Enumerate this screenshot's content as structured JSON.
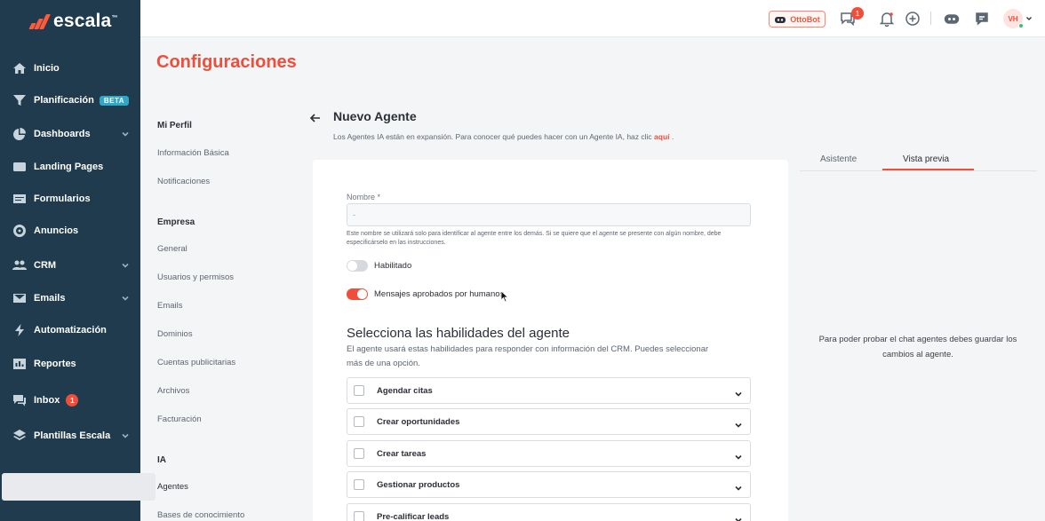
{
  "brand": {
    "name": "escala",
    "tm": "™"
  },
  "sidebar": {
    "items": [
      {
        "label": "Inicio",
        "icon": "home-icon"
      },
      {
        "label": "Planificación",
        "icon": "funnel-icon",
        "badge": "BETA"
      },
      {
        "label": "Dashboards",
        "icon": "pie-chart-icon",
        "expandable": true
      },
      {
        "label": "Landing Pages",
        "icon": "page-icon"
      },
      {
        "label": "Formularios",
        "icon": "form-icon"
      },
      {
        "label": "Anuncios",
        "icon": "target-icon"
      },
      {
        "label": "CRM",
        "icon": "users-icon",
        "expandable": true
      },
      {
        "label": "Emails",
        "icon": "mail-icon",
        "expandable": true
      },
      {
        "label": "Automatización",
        "icon": "bolt-icon"
      },
      {
        "label": "Reportes",
        "icon": "chart-icon"
      },
      {
        "label": "Inbox",
        "icon": "chat-icon",
        "count": "1"
      },
      {
        "label": "Plantillas Escala",
        "icon": "layers-icon",
        "expandable": true
      }
    ]
  },
  "topbar": {
    "ottobot_label": "OttoBot",
    "notification_count": "1",
    "avatar_initials": "VH"
  },
  "page": {
    "title": "Configuraciones"
  },
  "settings_menu": {
    "sections": [
      {
        "title": "Mi Perfil",
        "links": [
          "Información Básica",
          "Notificaciones"
        ]
      },
      {
        "title": "Empresa",
        "links": [
          "General",
          "Usuarios y permisos",
          "Emails",
          "Dominios",
          "Cuentas publicitarias",
          "Archivos",
          "Facturación"
        ]
      },
      {
        "title": "IA",
        "links": [
          "Agentes",
          "Bases de conocimiento"
        ]
      }
    ],
    "active": "Agentes"
  },
  "agent": {
    "title": "Nuevo Agente",
    "subtitle": "Los Agentes IA están en expansión. Para conocer qué puedes hacer con un Agente IA, haz clic",
    "subtitle_link": "aquí",
    "subtitle_end": ".",
    "name_label": "Nombre *",
    "name_value": "-",
    "name_help": "Este nombre se utilizará solo para identificar al agente entre los demás. Si se quiere que el agente se presente con algún nombre, debe especificárselo en las instrucciones.",
    "toggle_enabled_label": "Habilitado",
    "toggle_enabled": false,
    "toggle_human_label": "Mensajes aprobados por humanos",
    "toggle_human": true,
    "skills_title": "Selecciona las habilidades del agente",
    "skills_desc": "El agente usará estas habilidades para responder con información del CRM. Puedes seleccionar más de una opción.",
    "skills": [
      "Agendar citas",
      "Crear oportunidades",
      "Crear tareas",
      "Gestionar productos",
      "Pre-calificar leads"
    ]
  },
  "preview": {
    "tabs": [
      "Asistente",
      "Vista previa"
    ],
    "active_tab": "Vista previa",
    "message": "Para poder probar el chat agentes debes guardar los cambios al agente."
  },
  "colors": {
    "accent": "#ef4e3a",
    "sidebar": "#1f3b4d",
    "beta": "#2fa7c7"
  }
}
